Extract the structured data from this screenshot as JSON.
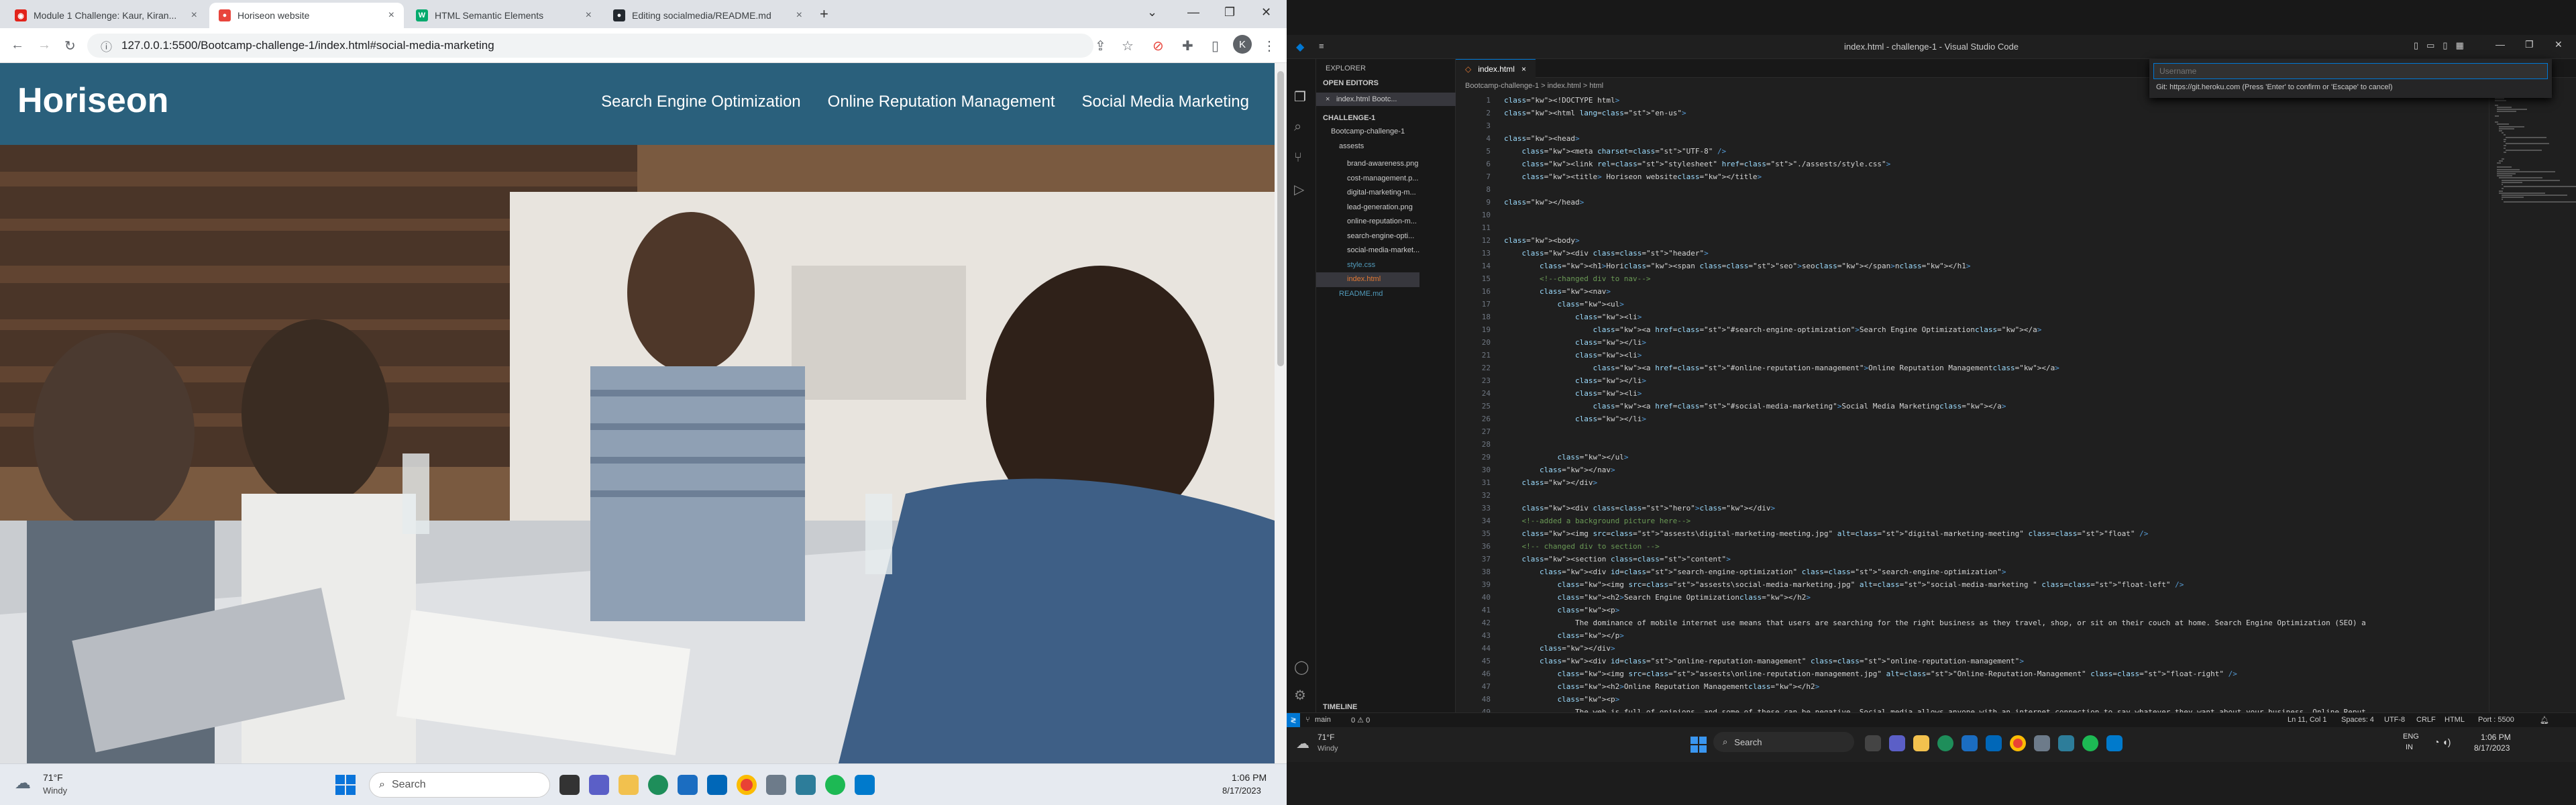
{
  "browser": {
    "tabs": [
      {
        "title": "Module 1 Challenge: Kaur, Kiran..."
      },
      {
        "title": "Horiseon website"
      },
      {
        "title": "HTML Semantic Elements"
      },
      {
        "title": "Editing socialmedia/README.md"
      }
    ],
    "url": "127.0.0.1:5500/Bootcamp-challenge-1/index.html#social-media-marketing",
    "profile_initial": "K"
  },
  "site": {
    "brand": "Horiseon",
    "nav": [
      "Search Engine Optimization",
      "Online Reputation Management",
      "Social Media Marketing"
    ]
  },
  "taskbar_left": {
    "weather_temp": "71°F",
    "weather_desc": "Windy",
    "search_placeholder": "Search",
    "time": "1:06 PM",
    "date": "8/17/2023"
  },
  "vscode": {
    "title": "index.html - challenge-1 - Visual Studio Code",
    "quick_input_placeholder": "Username",
    "quick_input_hint": "Git: https://git.heroku.com (Press 'Enter' to confirm or 'Escape' to cancel)",
    "explorer_header": "EXPLORER",
    "open_editors_header": "OPEN EDITORS",
    "open_editor_item": "index.html Bootc...",
    "project_header": "CHALLENGE-1",
    "folder_root": "Bootcamp-challenge-1",
    "assets_folder": "assests",
    "files": [
      "brand-awareness.png",
      "cost-management.p...",
      "digital-marketing-m...",
      "lead-generation.png",
      "online-reputation-m...",
      "search-engine-opti...",
      "social-media-market...",
      "style.css",
      "index.html",
      "README.md"
    ],
    "timeline_header": "TIMELINE",
    "active_tab": "index.html",
    "breadcrumb": "Bootcamp-challenge-1 > index.html > html",
    "code_lines": [
      "<!DOCTYPE html>",
      "<html lang=\"en-us\">",
      "",
      "<head>",
      "    <meta charset=\"UTF-8\" />",
      "    <link rel=\"stylesheet\" href=\"./assests/style.css\">",
      "    <title> Horiseon website</title>",
      "",
      "</head>",
      "",
      "",
      "<body>",
      "    <div class=\"header\">",
      "        <h1>Hori<span class=\"seo\">seo</span>n</h1>",
      "        <!--changed div to nav-->",
      "        <nav>",
      "            <ul>",
      "                <li>",
      "                    <a href=\"#search-engine-optimization\">Search Engine Optimization</a>",
      "                </li>",
      "                <li>",
      "                    <a href=\"#online-reputation-management\">Online Reputation Management</a>",
      "                </li>",
      "                <li>",
      "                    <a href=\"#social-media-marketing\">Social Media Marketing</a>",
      "                </li>",
      "",
      "",
      "            </ul>",
      "        </nav>",
      "    </div>",
      "",
      "    <div class=\"hero\"></div>",
      "    <!--added a background picture here-->",
      "    <img src=\"assests\\digital-marketing-meeting.jpg\" alt=\"digital-marketing-meeting\" class=\"float\" />",
      "    <!-- changed div to section -->",
      "    <section class=\"content\">",
      "        <div id=\"search-engine-optimization\" class=\"search-engine-optimization\">",
      "            <img src=\"assests\\social-media-marketing.jpg\" alt=\"social-media-marketing \" class=\"float-left\" />",
      "            <h2>Search Engine Optimization</h2>",
      "            <p>",
      "                The dominance of mobile internet use means that users are searching for the right business as they travel, shop, or sit on their couch at home. Search Engine Optimization (SEO) a",
      "            </p>",
      "        </div>",
      "        <div id=\"online-reputation-management\" class=\"online-reputation-management\">",
      "            <img src=\"assests\\online-reputation-management.jpg\" alt=\"Online-Reputation-Management\" class=\"float-right\" />",
      "            <h2>Online Reputation Management</h2>",
      "            <p>",
      "                The web is full of opinions, and some of these can be negative. Social media allows anyone with an internet connection to say whatever they want about your business. Online Reput"
    ],
    "status": {
      "branch": "main",
      "problems": "0 ⚠ 0",
      "cursor": "Ln 11, Col 1",
      "spaces": "Spaces: 4",
      "encoding": "UTF-8",
      "eol": "CRLF",
      "language": "HTML",
      "port": "Port : 5500"
    },
    "taskbar": {
      "weather_temp": "71°F",
      "weather_desc": "Windy",
      "search_placeholder": "Search",
      "lang": "ENG",
      "lang2": "IN",
      "time": "1:06 PM",
      "date": "8/17/2023"
    }
  },
  "colors": {
    "site_header": "#2a607c",
    "vscode_accent": "#0078d4",
    "code_tag": "#569cd6",
    "code_attr": "#9cdcfe",
    "code_string": "#ce9178",
    "code_comment": "#6a9955"
  }
}
